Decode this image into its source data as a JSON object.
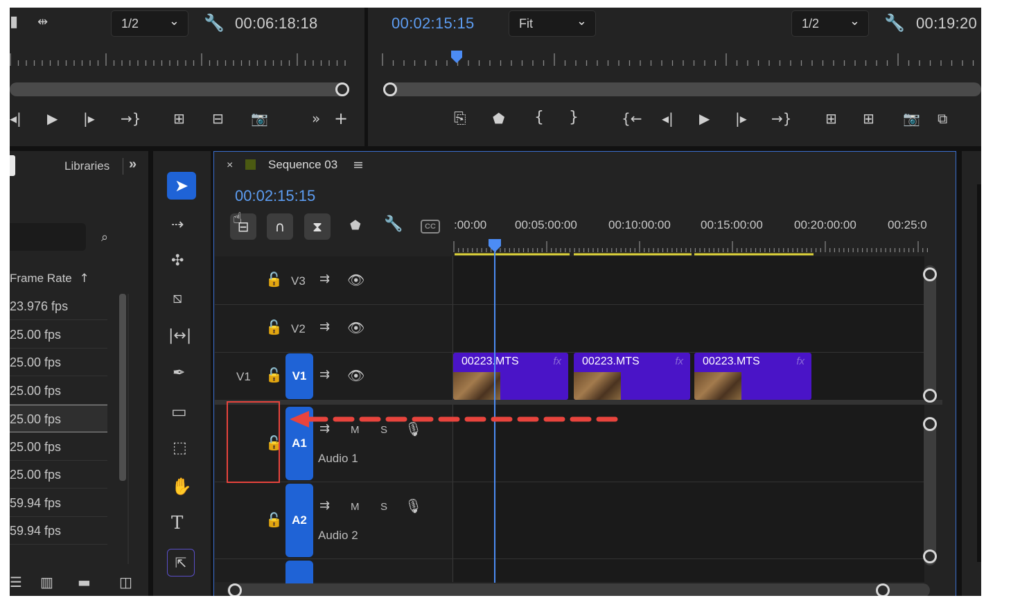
{
  "source_monitor": {
    "zoom": "1/2",
    "timecode": "00:06:18:18"
  },
  "program_monitor": {
    "current_time": "00:02:15:15",
    "fit": "Fit",
    "zoom": "1/2",
    "duration": "00:19:20"
  },
  "project_panel": {
    "tab_label": "Libraries",
    "column_header": "Frame Rate",
    "frame_rates": [
      "23.976 fps",
      "25.00 fps",
      "25.00 fps",
      "25.00 fps",
      "25.00 fps",
      "25.00 fps",
      "25.00 fps",
      "59.94 fps",
      "59.94 fps"
    ],
    "selected_index": 4
  },
  "timeline": {
    "close_label": "×",
    "sequence_name": "Sequence 03",
    "current_time": "00:02:15:15",
    "ruler_labels": [
      ":00:00",
      "00:05:00:00",
      "00:10:00:00",
      "00:15:00:00",
      "00:20:00:00",
      "00:25:0"
    ],
    "tracks": {
      "v3": "V3",
      "v2": "V2",
      "v1_source": "V1",
      "v1": "V1",
      "a1": "A1",
      "a1_name": "Audio 1",
      "a2": "A2",
      "a2_name": "Audio 2",
      "mute": "M",
      "solo": "S"
    },
    "clips": [
      {
        "name": "00223.MTS",
        "fx": "fx"
      },
      {
        "name": "00223.MTS",
        "fx": "fx"
      },
      {
        "name": "00223.MTS",
        "fx": "fx"
      }
    ]
  },
  "colors": {
    "clip": "#4a14c7",
    "track_target": "#1f63d6",
    "playhead": "#4c8cf5",
    "annotation": "#e8443d",
    "work_area": "#e0d63a"
  },
  "icons": [
    "wrench-icon",
    "play-icon",
    "step-forward-icon",
    "step-back-icon",
    "camera-icon",
    "marker-icon",
    "lock-icon",
    "eye-icon",
    "microphone-icon",
    "selection-tool-icon",
    "razor-tool-icon",
    "hand-tool-icon",
    "type-tool-icon",
    "pen-tool-icon"
  ]
}
